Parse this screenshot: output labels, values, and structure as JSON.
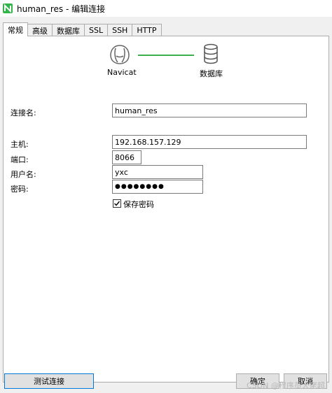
{
  "window": {
    "title": "human_res - 编辑连接"
  },
  "tabs": [
    {
      "label": "常规",
      "active": true
    },
    {
      "label": "高级",
      "active": false
    },
    {
      "label": "数据库",
      "active": false
    },
    {
      "label": "SSL",
      "active": false
    },
    {
      "label": "SSH",
      "active": false
    },
    {
      "label": "HTTP",
      "active": false
    }
  ],
  "diagram": {
    "left_label": "Navicat",
    "right_label": "数据库",
    "line_color": "#3cb14a"
  },
  "form": {
    "connection_name_label": "连接名:",
    "connection_name": "human_res",
    "host_label": "主机:",
    "host": "192.168.157.129",
    "port_label": "端口:",
    "port": "8066",
    "username_label": "用户名:",
    "username": "yxc",
    "password_label": "密码:",
    "password_masked": "●●●●●●●●",
    "save_password_label": "保存密码",
    "save_password_checked": true
  },
  "buttons": {
    "test": "测试连接",
    "ok": "确定",
    "cancel": "取消"
  },
  "watermark": "CSDN @程序员大佬超",
  "colors": {
    "accent": "#0078d7",
    "logo": "#2fb54a"
  }
}
